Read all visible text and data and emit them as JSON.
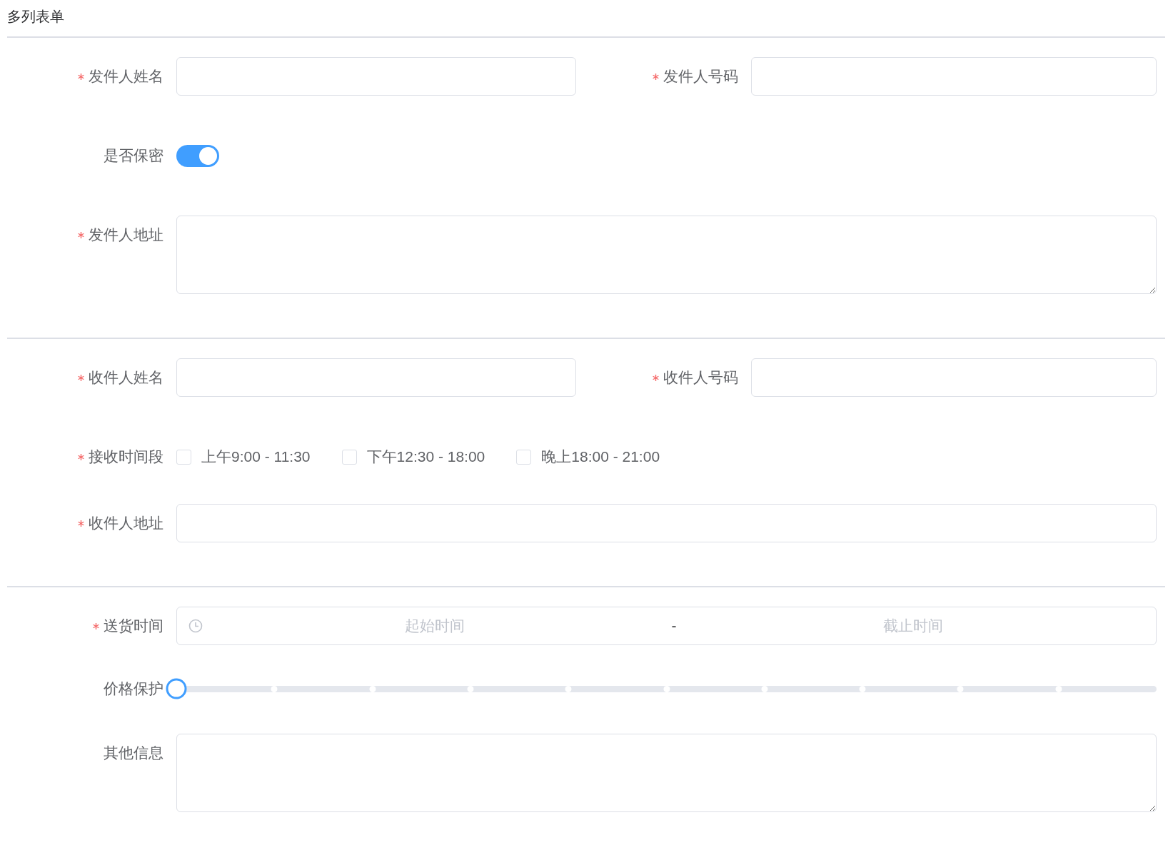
{
  "title": "多列表单",
  "sections": [
    {
      "rows": [
        {
          "kind": "inputs",
          "fields": [
            {
              "label": "发件人姓名",
              "required": true
            },
            {
              "label": "发件人号码",
              "required": true
            }
          ]
        },
        {
          "kind": "switch",
          "label": "是否保密",
          "required": false,
          "on": true
        },
        {
          "kind": "textarea",
          "label": "发件人地址",
          "required": true
        }
      ]
    },
    {
      "rows": [
        {
          "kind": "inputs",
          "fields": [
            {
              "label": "收件人姓名",
              "required": true
            },
            {
              "label": "收件人号码",
              "required": true
            }
          ]
        },
        {
          "kind": "checkboxes",
          "label": "接收时间段",
          "required": true,
          "options": [
            {
              "label": "上午9:00 - 11:30",
              "checked": false
            },
            {
              "label": "下午12:30 - 18:00",
              "checked": false
            },
            {
              "label": "晚上18:00 - 21:00",
              "checked": false
            }
          ]
        },
        {
          "kind": "input",
          "label": "收件人地址",
          "required": true
        }
      ]
    },
    {
      "rows": [
        {
          "kind": "time-range",
          "label": "送货时间",
          "required": true,
          "start_placeholder": "起始时间",
          "separator": "-",
          "end_placeholder": "截止时间"
        },
        {
          "kind": "slider",
          "label": "价格保护",
          "required": false,
          "level": 0
        },
        {
          "kind": "textarea",
          "label": "其他信息",
          "required": false
        }
      ]
    }
  ]
}
